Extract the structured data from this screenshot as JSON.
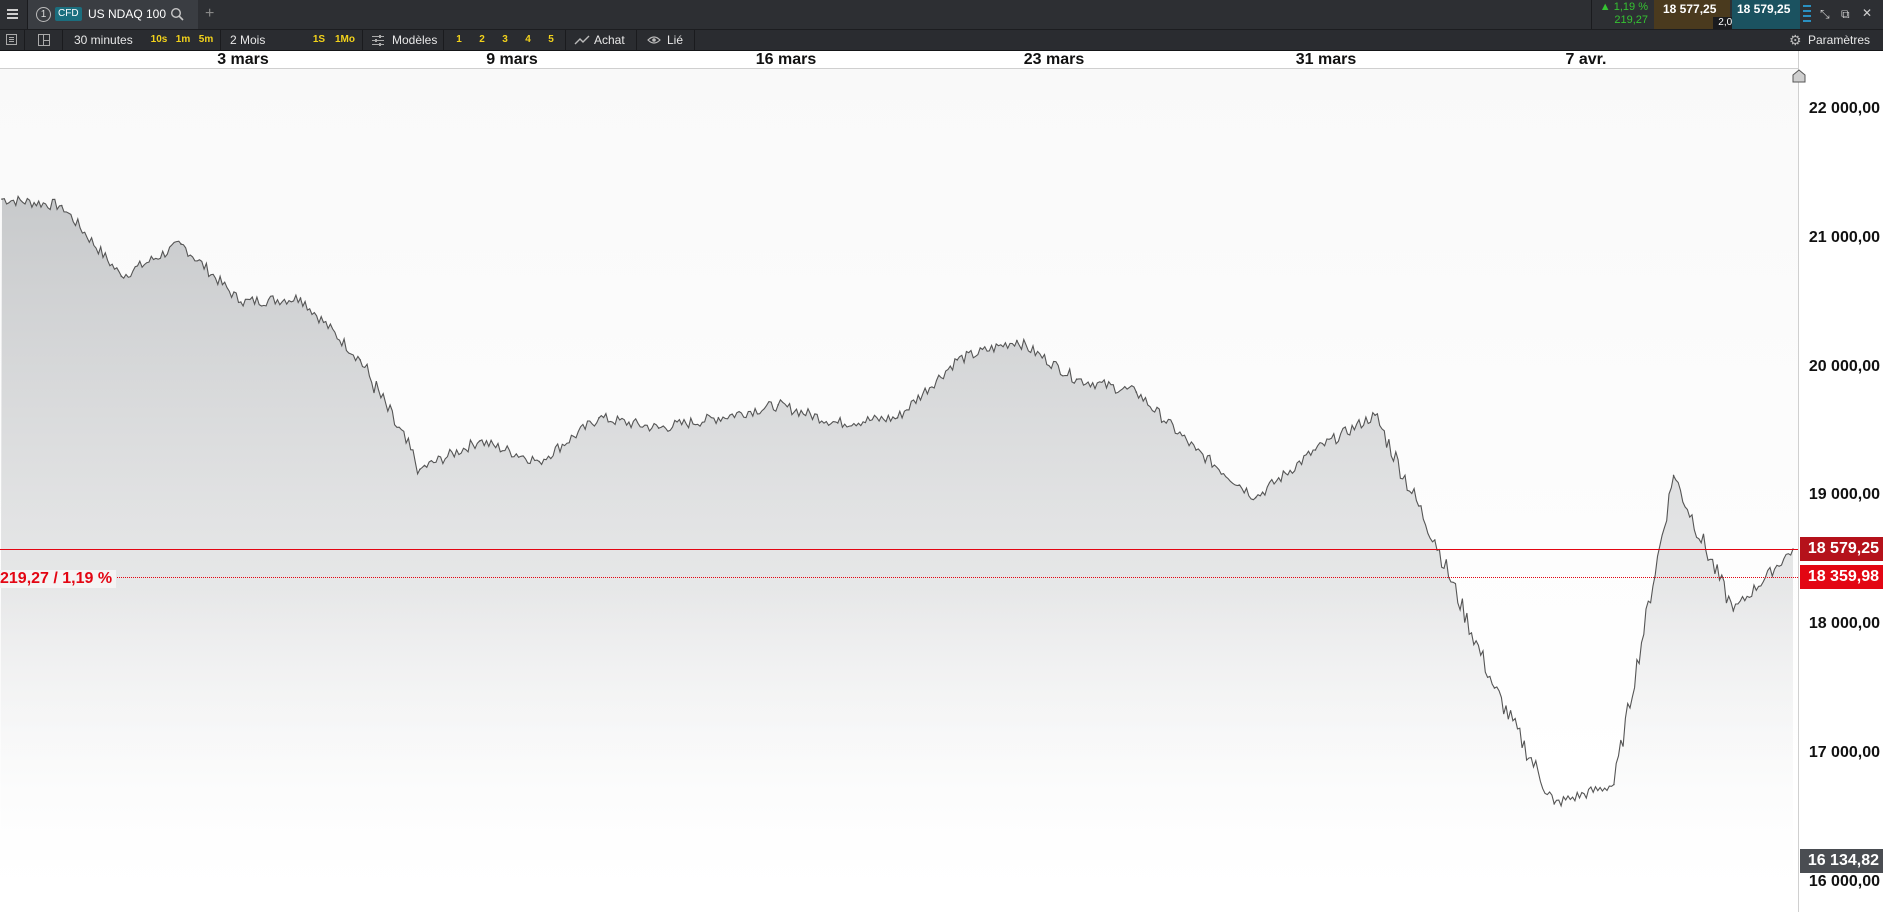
{
  "title_bar": {
    "tab_number": "1",
    "instrument_badge": "CFD",
    "instrument_name": "US NDAQ 100",
    "change_percent": "▲ 1,19 %",
    "change_points": "219,27",
    "bid_price": "18 577,25",
    "spread": "2,00",
    "ask_price": "18 579,25"
  },
  "toolbar": {
    "interval": "30 minutes",
    "quick_intervals": [
      "10s",
      "1m",
      "5m"
    ],
    "range": "2 Mois",
    "range_presets": [
      "1S",
      "1Mo"
    ],
    "templates_label": "Modèles",
    "layout_slots": [
      "1",
      "2",
      "3",
      "4",
      "5"
    ],
    "draw_label": "Achat",
    "linked_label": "Lié",
    "settings_label": "Paramètres"
  },
  "date_axis": [
    "3 mars",
    "9 mars",
    "16 mars",
    "23 mars",
    "31 mars",
    "7 avr."
  ],
  "price_axis": [
    "22 000,00",
    "21 000,00",
    "20 000,00",
    "19 000,00",
    "18 000,00",
    "17 000,00",
    "16 000,00"
  ],
  "markers": {
    "current_price": "18 579,25",
    "reference_price": "18 359,98",
    "low_price": "16 134,82",
    "change_label": "219,27 / 1,19 %"
  },
  "colors": {
    "accent_red": "#e30613",
    "highlight_yellow": "#f2d21b",
    "positive_green": "#35c232",
    "chart_line": "#555555"
  },
  "chart_data": {
    "type": "area",
    "title": "",
    "xlabel": "",
    "ylabel": "",
    "ylim": [
      15900,
      22300
    ],
    "x": [
      "2025-02-28",
      "2025-03-03",
      "2025-03-04",
      "2025-03-05",
      "2025-03-06",
      "2025-03-07",
      "2025-03-10",
      "2025-03-11",
      "2025-03-12",
      "2025-03-13",
      "2025-03-14",
      "2025-03-17",
      "2025-03-18",
      "2025-03-19",
      "2025-03-20",
      "2025-03-21",
      "2025-03-24",
      "2025-03-25",
      "2025-03-26",
      "2025-03-27",
      "2025-03-28",
      "2025-03-31",
      "2025-04-01",
      "2025-04-02",
      "2025-04-03",
      "2025-04-04",
      "2025-04-07",
      "2025-04-08",
      "2025-04-09",
      "2025-04-10",
      "2025-04-11"
    ],
    "series": [
      {
        "values": [
          21300,
          21250,
          20700,
          20950,
          20500,
          20530,
          20050,
          19200,
          19420,
          19260,
          19600,
          19520,
          19600,
          19700,
          19560,
          19600,
          20050,
          20200,
          19900,
          19800,
          19350,
          18980,
          19350,
          19620,
          18650,
          17500,
          16600,
          16750,
          19150,
          18100,
          18579.25
        ]
      }
    ]
  }
}
